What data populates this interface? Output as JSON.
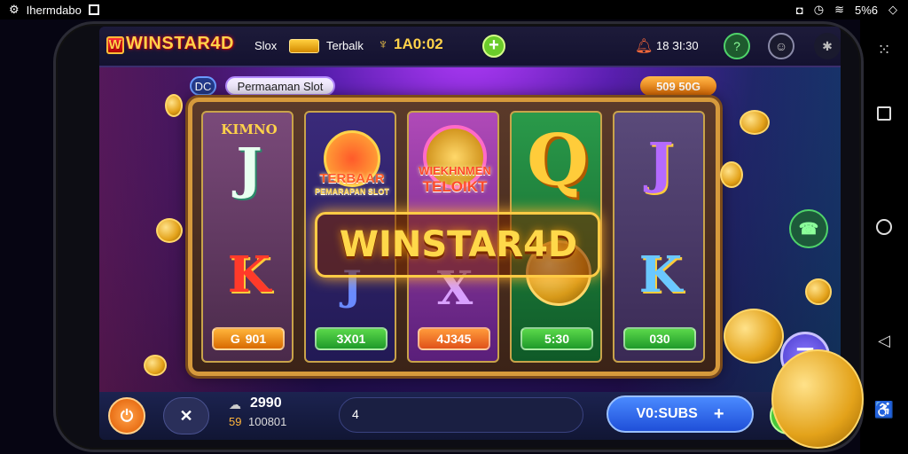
{
  "status_bar": {
    "app_name": "Ihermdabo",
    "right_text": "5%6"
  },
  "header": {
    "logo_text": "WINSTAR4D",
    "logo_w": "W",
    "nav_slot": "Slox",
    "nav_terbaik": "Terbalk",
    "coin_amount": "1А0:02",
    "plus_label": "+",
    "timer_text": "18 ЗІ:30"
  },
  "sub_header": {
    "tag_label": "DC",
    "category_label": "Permaaman Slot",
    "jackpot_label": "509 50G"
  },
  "reels": [
    {
      "top_text": "KIMNO",
      "top_symbol": "J",
      "bottom_symbol": "K",
      "value": "901",
      "value_prefix": "G",
      "color": "#6a3a6a"
    },
    {
      "top_text": "TERBAAR",
      "top_sub": "PEMARAPAN SLOT",
      "bottom_symbol": "J",
      "value": "3X01",
      "color": "#3a2a7a"
    },
    {
      "top_text": "WIEKHNMEN",
      "top_sub": "TELOIKT",
      "bottom_symbol": "X",
      "value": "4J345",
      "color": "#8a2a8a"
    },
    {
      "top_symbol": "Q",
      "bottom_symbol": "O",
      "value": "5:30",
      "color": "#1f7a3a"
    },
    {
      "top_symbol": "J",
      "bottom_symbol": "K",
      "value": "030",
      "color": "#4a3a6a"
    }
  ],
  "banner": {
    "title": "WINSTAR4D"
  },
  "bottom": {
    "balance": "2990",
    "sub_balance": "100801",
    "sub_prefix": "59",
    "input_value": "4",
    "spin_label": "V0:SUBS",
    "spin_plus": "+"
  },
  "icons": {
    "power": "power-icon",
    "shuffle": "shuffle-icon",
    "chat": "chat-icon",
    "menu": "menu-icon"
  },
  "colors": {
    "accent_gold": "#ffd24a",
    "spin_blue": "#2f6bff",
    "power_orange": "#ff7a1a",
    "green": "#47c83a"
  }
}
